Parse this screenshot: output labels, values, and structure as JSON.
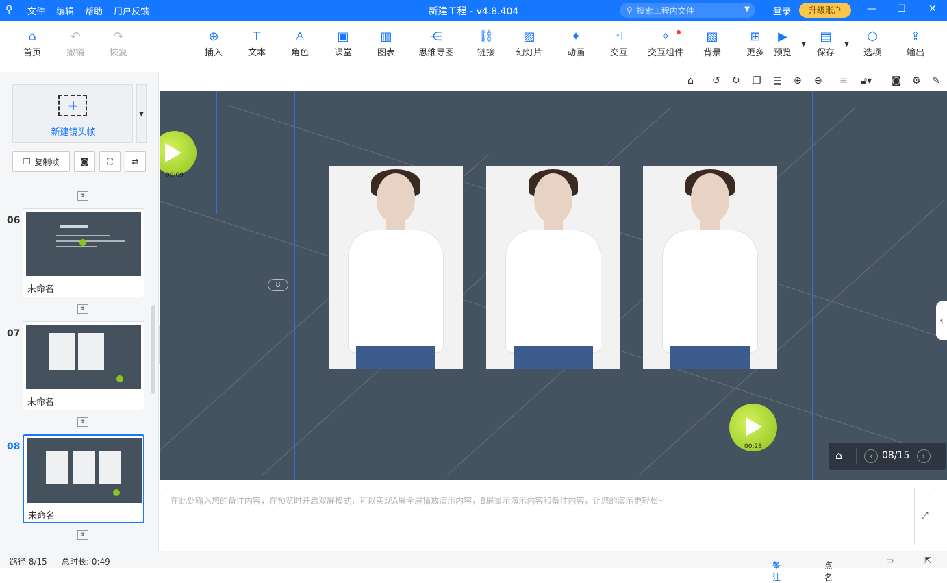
{
  "titlebar": {
    "app_icon": "app-logo-icon",
    "menus": [
      "文件",
      "编辑",
      "帮助",
      "用户反馈"
    ],
    "title": "新建工程 - v4.8.404",
    "search_placeholder": "搜索工程内文件",
    "login": "登录",
    "upgrade": "升级账户",
    "controls": [
      "—",
      "☐",
      "✕"
    ]
  },
  "toolbar": {
    "items": [
      {
        "label": "首页",
        "icon": "home-icon",
        "glyph": "⌂"
      },
      {
        "label": "撤销",
        "icon": "undo-icon",
        "glyph": "↶"
      },
      {
        "label": "恢复",
        "icon": "redo-icon",
        "glyph": "↷"
      },
      {
        "label": "插入",
        "icon": "plus-circle-icon",
        "glyph": "⊕"
      },
      {
        "label": "文本",
        "icon": "text-icon",
        "glyph": "T"
      },
      {
        "label": "角色",
        "icon": "character-icon",
        "glyph": "♙"
      },
      {
        "label": "课堂",
        "icon": "classroom-icon",
        "glyph": "▣"
      },
      {
        "label": "图表",
        "icon": "chart-icon",
        "glyph": "▥"
      },
      {
        "label": "思维导图",
        "icon": "mindmap-icon",
        "glyph": "⋲"
      },
      {
        "label": "链接",
        "icon": "link-icon",
        "glyph": "⛓"
      },
      {
        "label": "幻灯片",
        "icon": "slide-icon",
        "glyph": "▨"
      },
      {
        "label": "动画",
        "icon": "animation-icon",
        "glyph": "✦"
      },
      {
        "label": "交互",
        "icon": "interact-icon",
        "glyph": "☝"
      },
      {
        "label": "交互组件",
        "icon": "interact-component-icon",
        "glyph": "✧"
      },
      {
        "label": "背景",
        "icon": "background-icon",
        "glyph": "▧"
      },
      {
        "label": "更多",
        "icon": "more-grid-icon",
        "glyph": "⊞"
      },
      {
        "label": "预览",
        "icon": "preview-icon",
        "glyph": "▶"
      },
      {
        "label": "保存",
        "icon": "save-icon",
        "glyph": "▤"
      },
      {
        "label": "选项",
        "icon": "options-icon",
        "glyph": "⬡"
      },
      {
        "label": "输出",
        "icon": "export-icon",
        "glyph": "⇪"
      }
    ]
  },
  "leftpanel": {
    "new_frame_label": "新建镜头帧",
    "copy_frame_label": "复制帧",
    "slides": [
      {
        "num": "06",
        "name": "未命名"
      },
      {
        "num": "07",
        "name": "未命名"
      },
      {
        "num": "08",
        "name": "未命名"
      }
    ]
  },
  "stage": {
    "play_top_time": "00:09",
    "play_bottom_time": "00:28",
    "page_badge": "8",
    "nav_page": "08/15"
  },
  "notes": {
    "placeholder": "在此处输入您的备注内容，在预览时开启双屏模式，可以实现A屏全屏播放演示内容，B屏显示演示内容和备注内容，让您的演示更轻松~"
  },
  "statusbar": {
    "path": "路径 8/15",
    "duration": "总时长: 0:49",
    "notes_btn": "备注",
    "rollcall_btn": "点名"
  },
  "colors": {
    "accent": "#1677ff",
    "stage_bg": "#455260",
    "upgrade_bg": "#f7c64a",
    "play_green": "#8dc21f"
  }
}
